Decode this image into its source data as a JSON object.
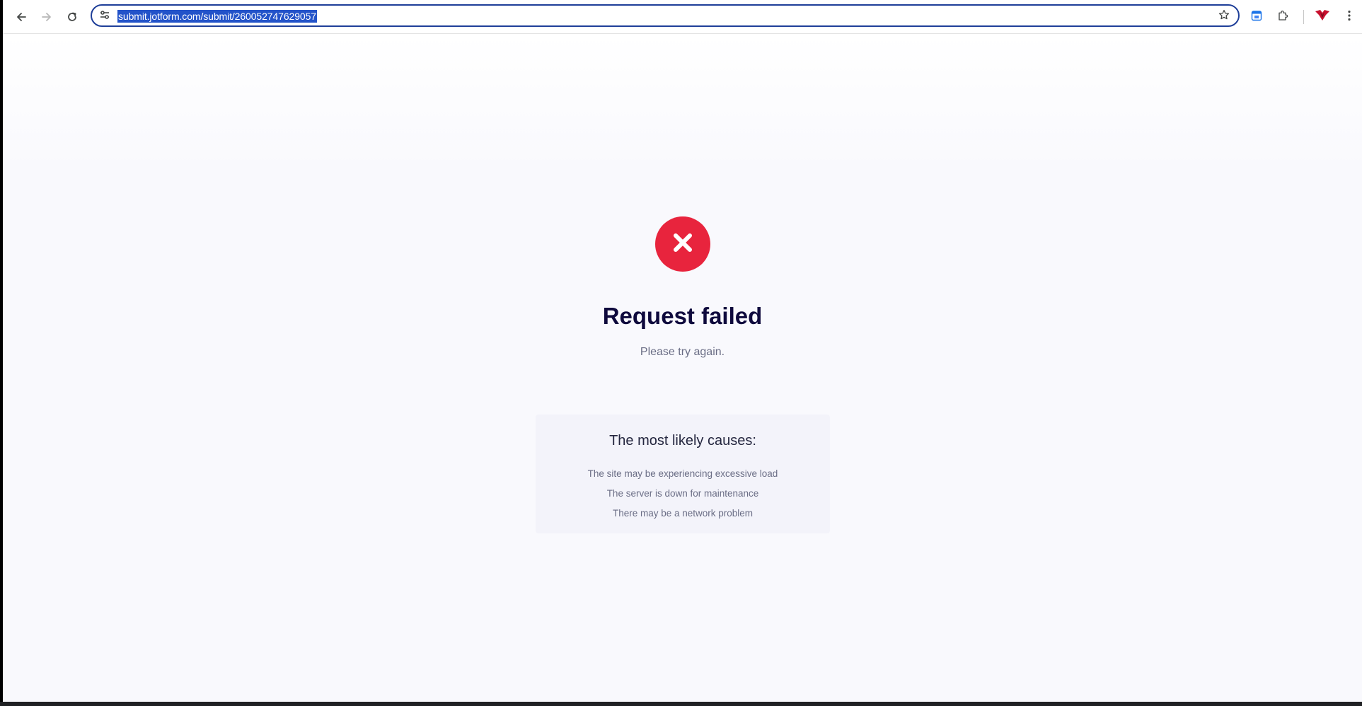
{
  "browser": {
    "url": "submit.jotform.com/submit/260052747629057",
    "icons": {
      "back": "arrow-left-icon",
      "forward": "arrow-right-icon",
      "reload": "reload-icon",
      "site_info": "tune-icon",
      "bookmark": "star-icon",
      "calendar_extension": "calendar-icon",
      "extensions": "puzzle-icon",
      "profile_extension": "red-bird-icon",
      "menu": "kebab-menu-icon"
    },
    "colors": {
      "omnibox_border": "#1f3f99",
      "url_selection": "#2353c9"
    }
  },
  "page": {
    "status_icon": "close-icon",
    "status_color": "#e8243d",
    "headline": "Request failed",
    "subtitle": "Please try again.",
    "causes": {
      "title": "The most likely causes:",
      "items": [
        {
          "text": "The site may be experiencing excessive load"
        },
        {
          "text": "The server is down for maintenance"
        },
        {
          "text": "There may be a network problem"
        }
      ]
    }
  }
}
